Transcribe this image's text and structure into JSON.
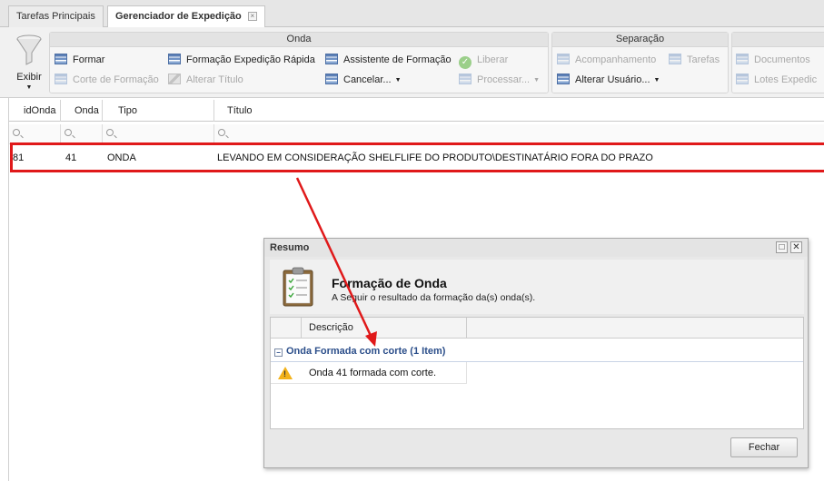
{
  "tabs": [
    {
      "label": "Tarefas Principais"
    },
    {
      "label": "Gerenciador de Expedição"
    }
  ],
  "tab_close_glyph": "×",
  "ribbon": {
    "exibir": {
      "label": "Exibir",
      "arrow": "▼",
      "icon": "funnel-icon"
    },
    "onda": {
      "title": "Onda",
      "formar": "Formar",
      "corte_formacao": "Corte de Formação",
      "formacao_rapida": "Formação Expedição Rápida",
      "alterar_titulo": "Alterar Título",
      "assistente": "Assistente de Formação",
      "cancelar": "Cancelar...",
      "liberar": "Liberar",
      "processar": "Processar..."
    },
    "separacao": {
      "title": "Separação",
      "acompanhamento": "Acompanhamento",
      "tarefas": "Tarefas",
      "alterar_usuario": "Alterar Usuário..."
    },
    "documentos": {
      "documentos": "Documentos",
      "lotes": "Lotes Expedic"
    }
  },
  "grid": {
    "columns": [
      "idOnda",
      "Onda",
      "Tipo",
      "Título"
    ],
    "rows": [
      {
        "idOnda": "81",
        "onda": "41",
        "tipo": "ONDA",
        "titulo": "LEVANDO EM CONSIDERAÇÃO SHELFLIFE DO PRODUTO\\DESTINATÁRIO FORA DO PRAZO"
      }
    ]
  },
  "dialog": {
    "title": "Resumo",
    "maximize_glyph": "□",
    "close_glyph": "✕",
    "heading": "Formação de Onda",
    "subheading": "A Seguir o resultado da formação da(s) onda(s).",
    "column": "Descrição",
    "group_toggle": "−",
    "group": "Onda Formada com corte (1 Item)",
    "row_mark": "!",
    "row": "Onda 41 formada com corte.",
    "close_button": "Fechar"
  },
  "colors": {
    "highlight": "#e0191a",
    "group_text": "#2b4e8a",
    "warning": "#f3b21a"
  }
}
